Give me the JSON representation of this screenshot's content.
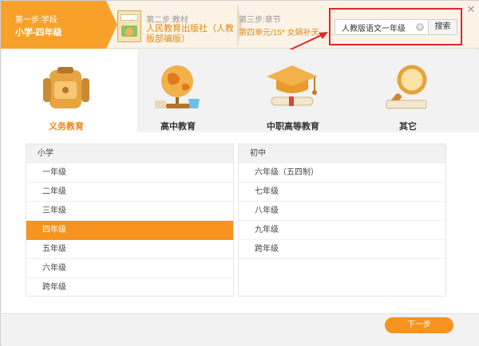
{
  "steps": {
    "step1": {
      "label": "第一步:学段",
      "value": "小学-四年级"
    },
    "step2": {
      "label": "第二步:教材",
      "value": "人民教育出版社（人教版部编版）"
    },
    "step3": {
      "label": "第三步:章节",
      "value": "第四单元/15* 女娲补天"
    }
  },
  "search": {
    "value": "人教版语文一年级",
    "button_label": "搜索",
    "clear_symbol": "⊗"
  },
  "close_symbol": "✕",
  "categories": [
    {
      "label": "义务教育",
      "icon": "backpack-icon",
      "active": true
    },
    {
      "label": "高中教育",
      "icon": "globe-icon",
      "active": false
    },
    {
      "label": "中职高等教育",
      "icon": "graduation-cap-icon",
      "active": false
    },
    {
      "label": "其它",
      "icon": "magnifier-icon",
      "active": false
    }
  ],
  "panel_left": {
    "header": "小学",
    "items": [
      "一年级",
      "二年级",
      "三年级",
      "四年级",
      "五年级",
      "六年级",
      "跨年级"
    ],
    "selected": "四年级"
  },
  "panel_right": {
    "header": "初中",
    "items": [
      "六年级（五四制）",
      "七年级",
      "八年级",
      "九年级",
      "跨年级"
    ]
  },
  "footer": {
    "next_label": "下一步"
  },
  "colors": {
    "accent": "#f7931e",
    "highlight_border": "#e0262b",
    "step_text": "#e08b16"
  }
}
